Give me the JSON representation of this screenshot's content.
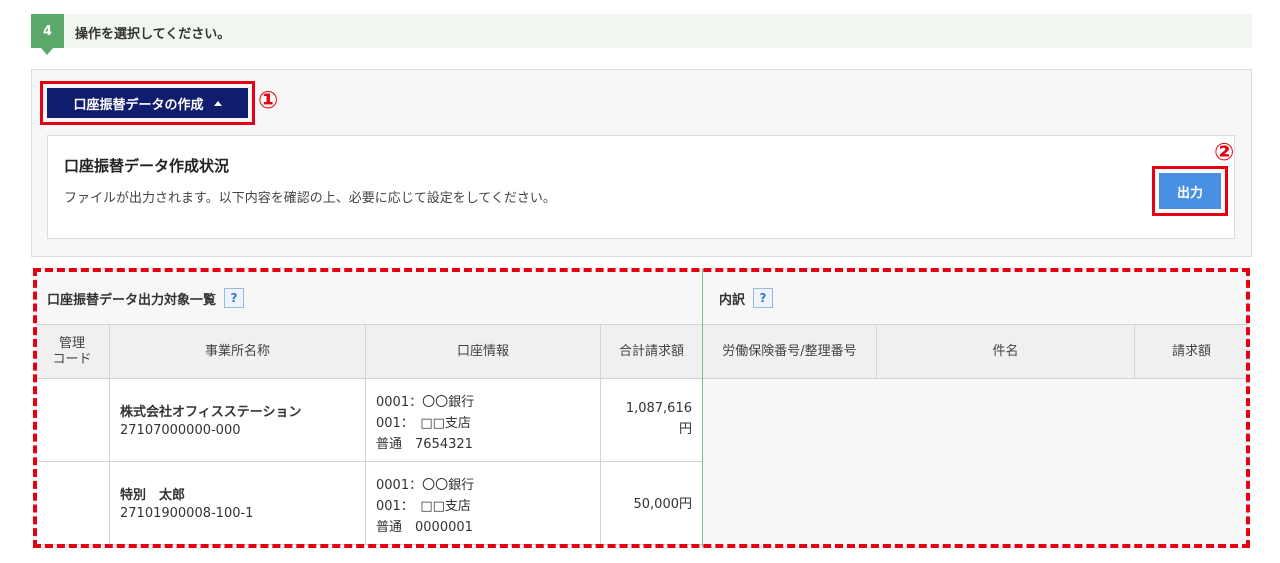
{
  "step": {
    "number": "4",
    "text": "操作を選択してください。"
  },
  "toggle": {
    "label": "口座振替データの作成",
    "marker": "①"
  },
  "status_card": {
    "title": "口座振替データ作成状況",
    "description": "ファイルが出力されます。以下内容を確認の上、必要に応じて設定をしてください。",
    "output_label": "出力",
    "marker": "②"
  },
  "list_section": {
    "title": "口座振替データ出力対象一覧",
    "help": "?"
  },
  "detail_section": {
    "title": "内訳",
    "help": "?"
  },
  "list_headers": [
    "管理\nコード",
    "事業所名称",
    "口座情報",
    "合計請求額"
  ],
  "detail_headers": [
    "労働保険番号/整理番号",
    "件名",
    "請求額"
  ],
  "rows": [
    {
      "code": "",
      "office_name": "株式会社オフィスステーション",
      "office_code": "27107000000-000",
      "account": [
        "0001：〇〇銀行",
        "001：　□□支店",
        "普通　7654321"
      ],
      "amount_line1": "1,087,616",
      "amount_line2": "円"
    },
    {
      "code": "",
      "office_name": "特別　太郎",
      "office_code": "27101900008-100-1",
      "account": [
        "0001：〇〇銀行",
        "001：　□□支店",
        "普通　0000001"
      ],
      "amount_line1": "50,000円",
      "amount_line2": ""
    }
  ],
  "colors": {
    "accent_navy": "#101c6e",
    "step_green": "#5aa96b",
    "highlight_red": "#e60012",
    "output_blue": "#4a90e2"
  }
}
